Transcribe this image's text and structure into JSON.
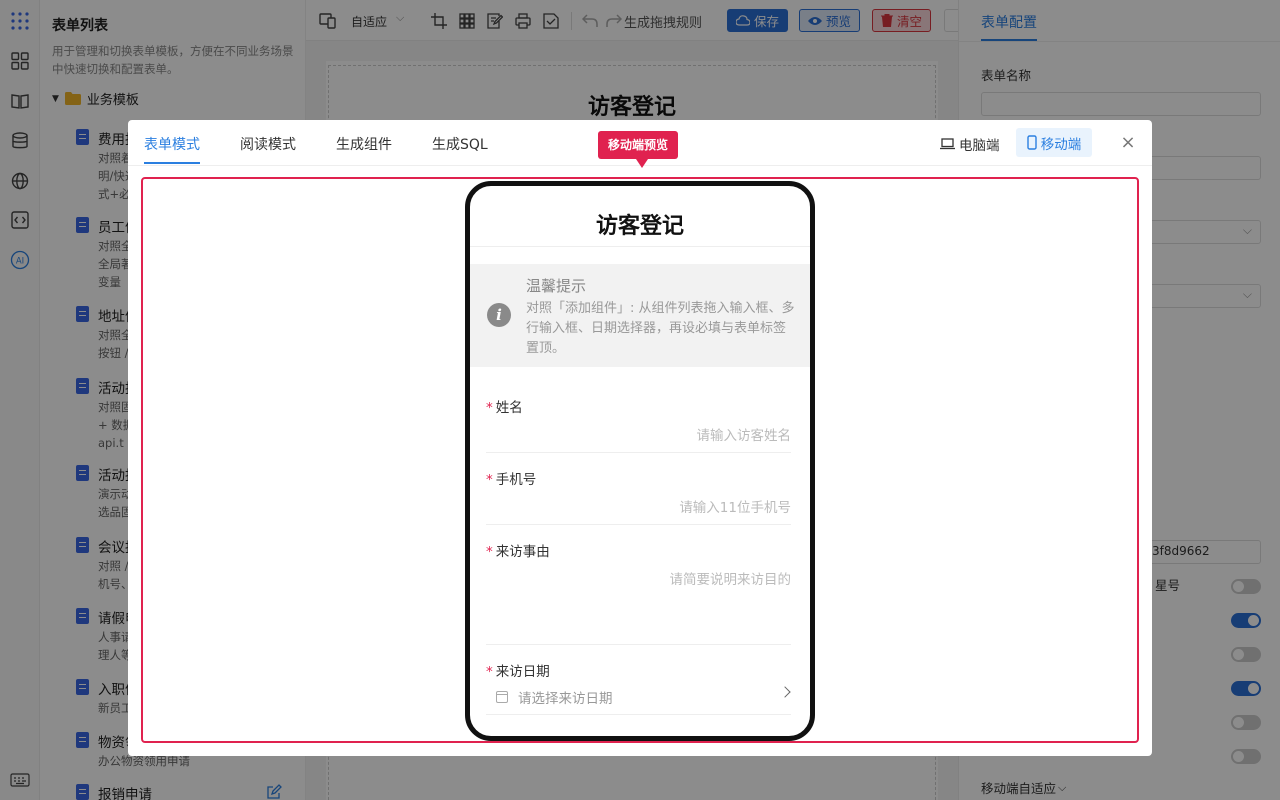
{
  "sidebar": {
    "title": "表单列表",
    "description": "用于管理和切换表单模板，方便在不同业务场景中快速切换和配置表单。",
    "folder": "业务模板",
    "items": [
      {
        "title": "费用报",
        "desc": "对照着\n明/快递\n式+必"
      },
      {
        "title": "员工信",
        "desc": "对照全\n全局著\n变量"
      },
      {
        "title": "地址信",
        "desc": "对照全\n按钮 /"
      },
      {
        "title": "活动报",
        "desc": "对照固\n+ 数据\napi.t"
      },
      {
        "title": "活动报",
        "desc": "演示动\n选品固"
      },
      {
        "title": "会议报",
        "desc": "对照 /\n机号、"
      },
      {
        "title": "请假申",
        "desc": "人事请\n理人等"
      },
      {
        "title": "入职信",
        "desc": "新员工"
      },
      {
        "title": "物资领",
        "desc": "办公物资领用申请"
      },
      {
        "title": "报销申请",
        "desc": ""
      }
    ]
  },
  "toolbar": {
    "layout_select": "自适应",
    "rule_label": "生成拖拽规则",
    "save": "保存",
    "preview": "预览",
    "clear": "清空"
  },
  "canvas": {
    "form_title": "访客登记"
  },
  "right_panel": {
    "tab": "表单配置",
    "form_name_label": "表单名称",
    "id_fragment": "3f8d9662",
    "asterisk_label": "星号",
    "mobile_adapt": "移动端自适应"
  },
  "modal": {
    "tabs": [
      "表单模式",
      "阅读模式",
      "生成组件",
      "生成SQL"
    ],
    "badge": "移动端预览",
    "device_pc": "电脑端",
    "device_mobile": "移动端",
    "close": "×"
  },
  "phone": {
    "title": "访客登记",
    "tip_title": "温馨提示",
    "tip_text": "对照「添加组件」: 从组件列表拖入输入框、多行输入框、日期选择器，再设必填与表单标签置顶。",
    "fields": [
      {
        "label": "姓名",
        "placeholder": "请输入访客姓名"
      },
      {
        "label": "手机号",
        "placeholder": "请输入11位手机号"
      },
      {
        "label": "来访事由",
        "placeholder": "请简要说明来访目的"
      },
      {
        "label": "来访日期",
        "placeholder": "请选择来访日期"
      }
    ]
  },
  "colors": {
    "accent": "#2b7fe0",
    "highlight": "#e0224f"
  }
}
